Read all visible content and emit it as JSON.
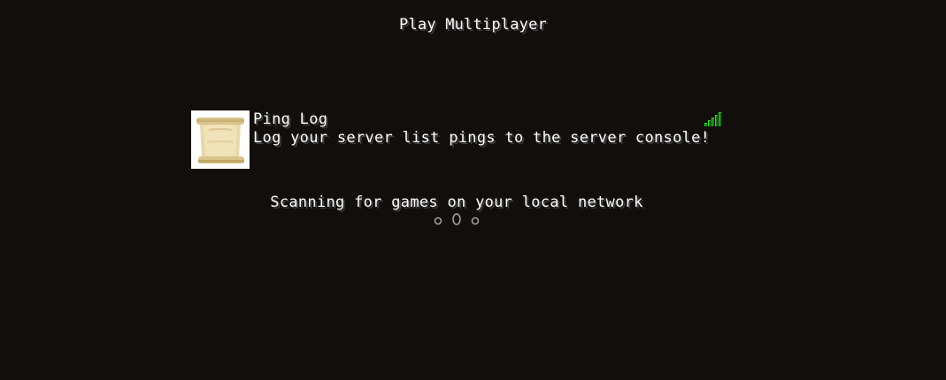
{
  "screen": {
    "title": "Play Multiplayer"
  },
  "server_list": [
    {
      "name": "Ping Log",
      "motd": "Log your server list pings to the server console!",
      "icon": "scroll-icon",
      "ping_icon": "signal-bars-icon",
      "ping_bars": 5,
      "ping_color": "#22dd22"
    }
  ],
  "lan": {
    "status_text": "Scanning for games on your local network",
    "spinner": "o0o",
    "spinner_icon": "loading-dots-icon"
  },
  "colors": {
    "background": "#120e0b",
    "text": "#ffffff",
    "spinner": "#a0a0a0"
  }
}
